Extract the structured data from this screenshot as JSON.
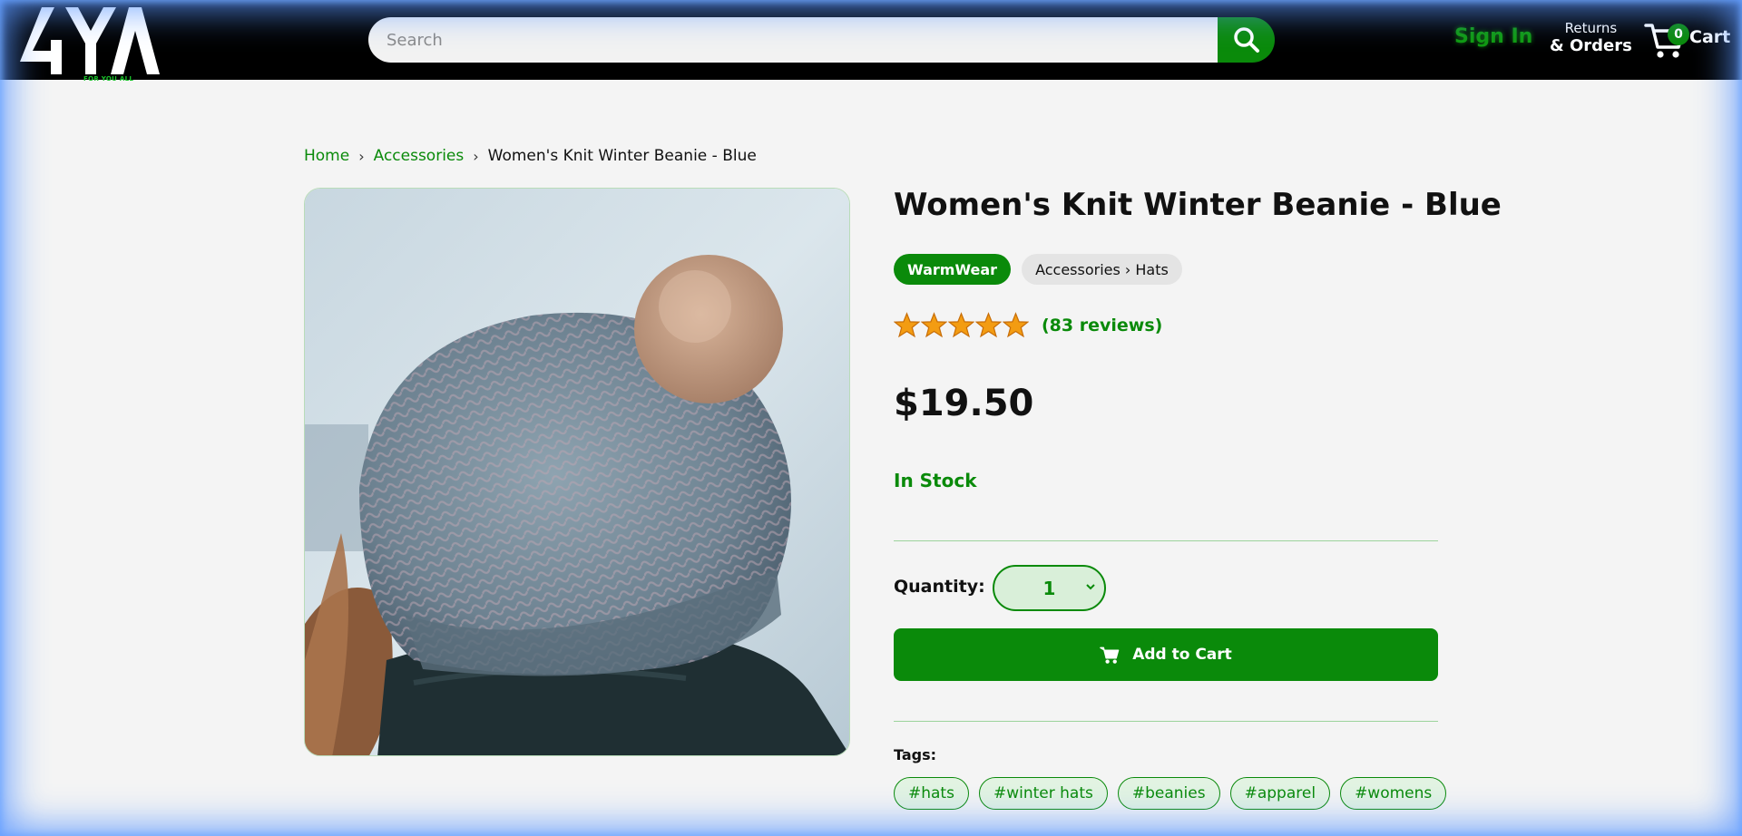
{
  "header": {
    "logo_text": "4YA",
    "logo_tagline": "FOR YOU ALL",
    "search_placeholder": "Search",
    "sign_in": "Sign In",
    "returns_line1": "Returns",
    "returns_line2": "& Orders",
    "cart_count": "0",
    "cart_label": "Cart"
  },
  "breadcrumb": {
    "home": "Home",
    "category": "Accessories",
    "separator": "›",
    "current": "Women's Knit Winter Beanie - Blue"
  },
  "product": {
    "title": "Women's Knit Winter Beanie - Blue",
    "brand": "WarmWear",
    "category_path": "Accessories › Hats",
    "rating_stars": 5,
    "reviews": "(83 reviews)",
    "price": "$19.50",
    "stock_status": "In Stock",
    "quantity_label": "Quantity:",
    "quantity_value": "1",
    "add_to_cart": "Add to Cart",
    "tags_label": "Tags:",
    "tags": [
      "#hats",
      "#winter hats",
      "#beanies",
      "#apparel",
      "#womens"
    ]
  },
  "colors": {
    "accent": "#0a8a0a",
    "header_bg": "#000000",
    "page_bg": "#f4f4f4",
    "star": "#f39c12"
  },
  "icons": {
    "search": "search-icon",
    "cart": "cart-icon",
    "star": "star-icon",
    "chevron": "chevron-down-icon"
  }
}
